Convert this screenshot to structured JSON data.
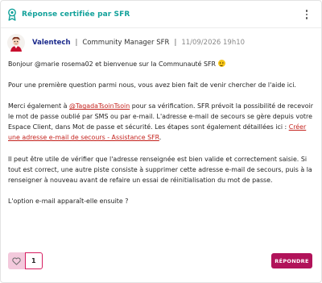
{
  "header": {
    "badge_text": "Réponse certifiée par SFR",
    "badge_icon": "certified-ribbon-icon",
    "menu_icon": "more-vertical-icon"
  },
  "author": {
    "name": "Valentech",
    "separator": "|",
    "role": "Community Manager SFR",
    "date_separator": "|",
    "date": "11/09/2026 19h10",
    "avatar_icon": "avatar-illustration"
  },
  "post": {
    "p1_text": "Bonjour @marie rosema02 et bienvenue sur la Communauté SFR",
    "p1_emoji": "smiling-face-icon",
    "p2": "Pour une première question parmi nous, vous avez bien fait de venir chercher de l'aide ici.",
    "p3_before": "Merci également à ",
    "p3_mention": "@TagadaTsoinTsoin",
    "p3_after": " pour sa vérification. SFR prévoit la possibilité de recevoir le mot de passe oublié par SMS ou par e-mail. L'adresse e-mail de secours se gère depuis votre Espace Client, dans Mot de passe et sécurité. Les étapes sont également détaillées ici : ",
    "p3_link": "Créer une adresse e-mail de secours - Assistance SFR",
    "p3_end": ".",
    "p4": "Il peut être utile de vérifier que l'adresse renseignée est bien valide et correctement saisie. Si tout est correct, une autre piste consiste à supprimer cette adresse e-mail de secours, puis à la renseigner à nouveau avant de refaire un essai de réinitialisation du mot de passe.",
    "p5": "L'option e-mail apparaît-elle ensuite ?"
  },
  "footer": {
    "like_icon": "heart-icon",
    "like_count": "1",
    "reply_label": "RÉPONDRE"
  },
  "colors": {
    "accent_teal": "#12a19a",
    "author_blue": "#1b2a8c",
    "link_red": "#c4231e",
    "reply_bg": "#b1135a",
    "like_bg": "#f3c9dc",
    "like_border": "#d61d60"
  }
}
